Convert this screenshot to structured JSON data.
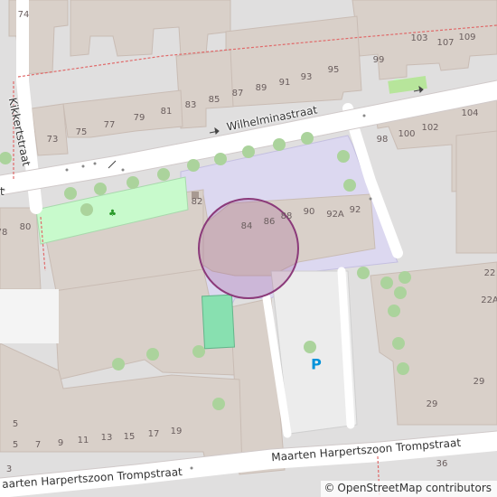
{
  "map": {
    "streets": [
      {
        "id": "wilhelminastraat",
        "label": "Wilhelminastraat"
      },
      {
        "id": "kikkertstraat",
        "label": "Kikkertstraat"
      },
      {
        "id": "trompstraat-east",
        "label": "Maarten Harpertszoon Trompstraat"
      },
      {
        "id": "trompstraat-west",
        "label": "aarten Harpertszoon Trompstraat"
      },
      {
        "id": "edge-t",
        "label": "t"
      }
    ],
    "house_numbers": [
      "74",
      "103",
      "107",
      "109",
      "99",
      "95",
      "93",
      "91",
      "89",
      "87",
      "85",
      "83",
      "81",
      "79",
      "77",
      "75",
      "73",
      "104",
      "98",
      "100",
      "102",
      "82",
      "84",
      "86",
      "88",
      "90",
      "92A",
      "92",
      "78",
      "80",
      "29",
      "22A",
      "22",
      "5",
      "7",
      "9",
      "11",
      "13",
      "15",
      "17",
      "19",
      "29",
      "36",
      "5",
      "3"
    ],
    "parking_label": "P",
    "selection_circle": {
      "color": "#8b3a7a",
      "fill": "rgba(150,70,130,0.22)"
    },
    "colors": {
      "building": "#d9d0c9",
      "road": "#ffffff",
      "park": "#c8facc",
      "landuse": "#e0dfdf",
      "school": "#dcd8f0",
      "pitch": "#88e0b0",
      "tree": "#abd39c"
    }
  },
  "attribution": {
    "symbol": "©",
    "text": "OpenStreetMap contributors"
  }
}
